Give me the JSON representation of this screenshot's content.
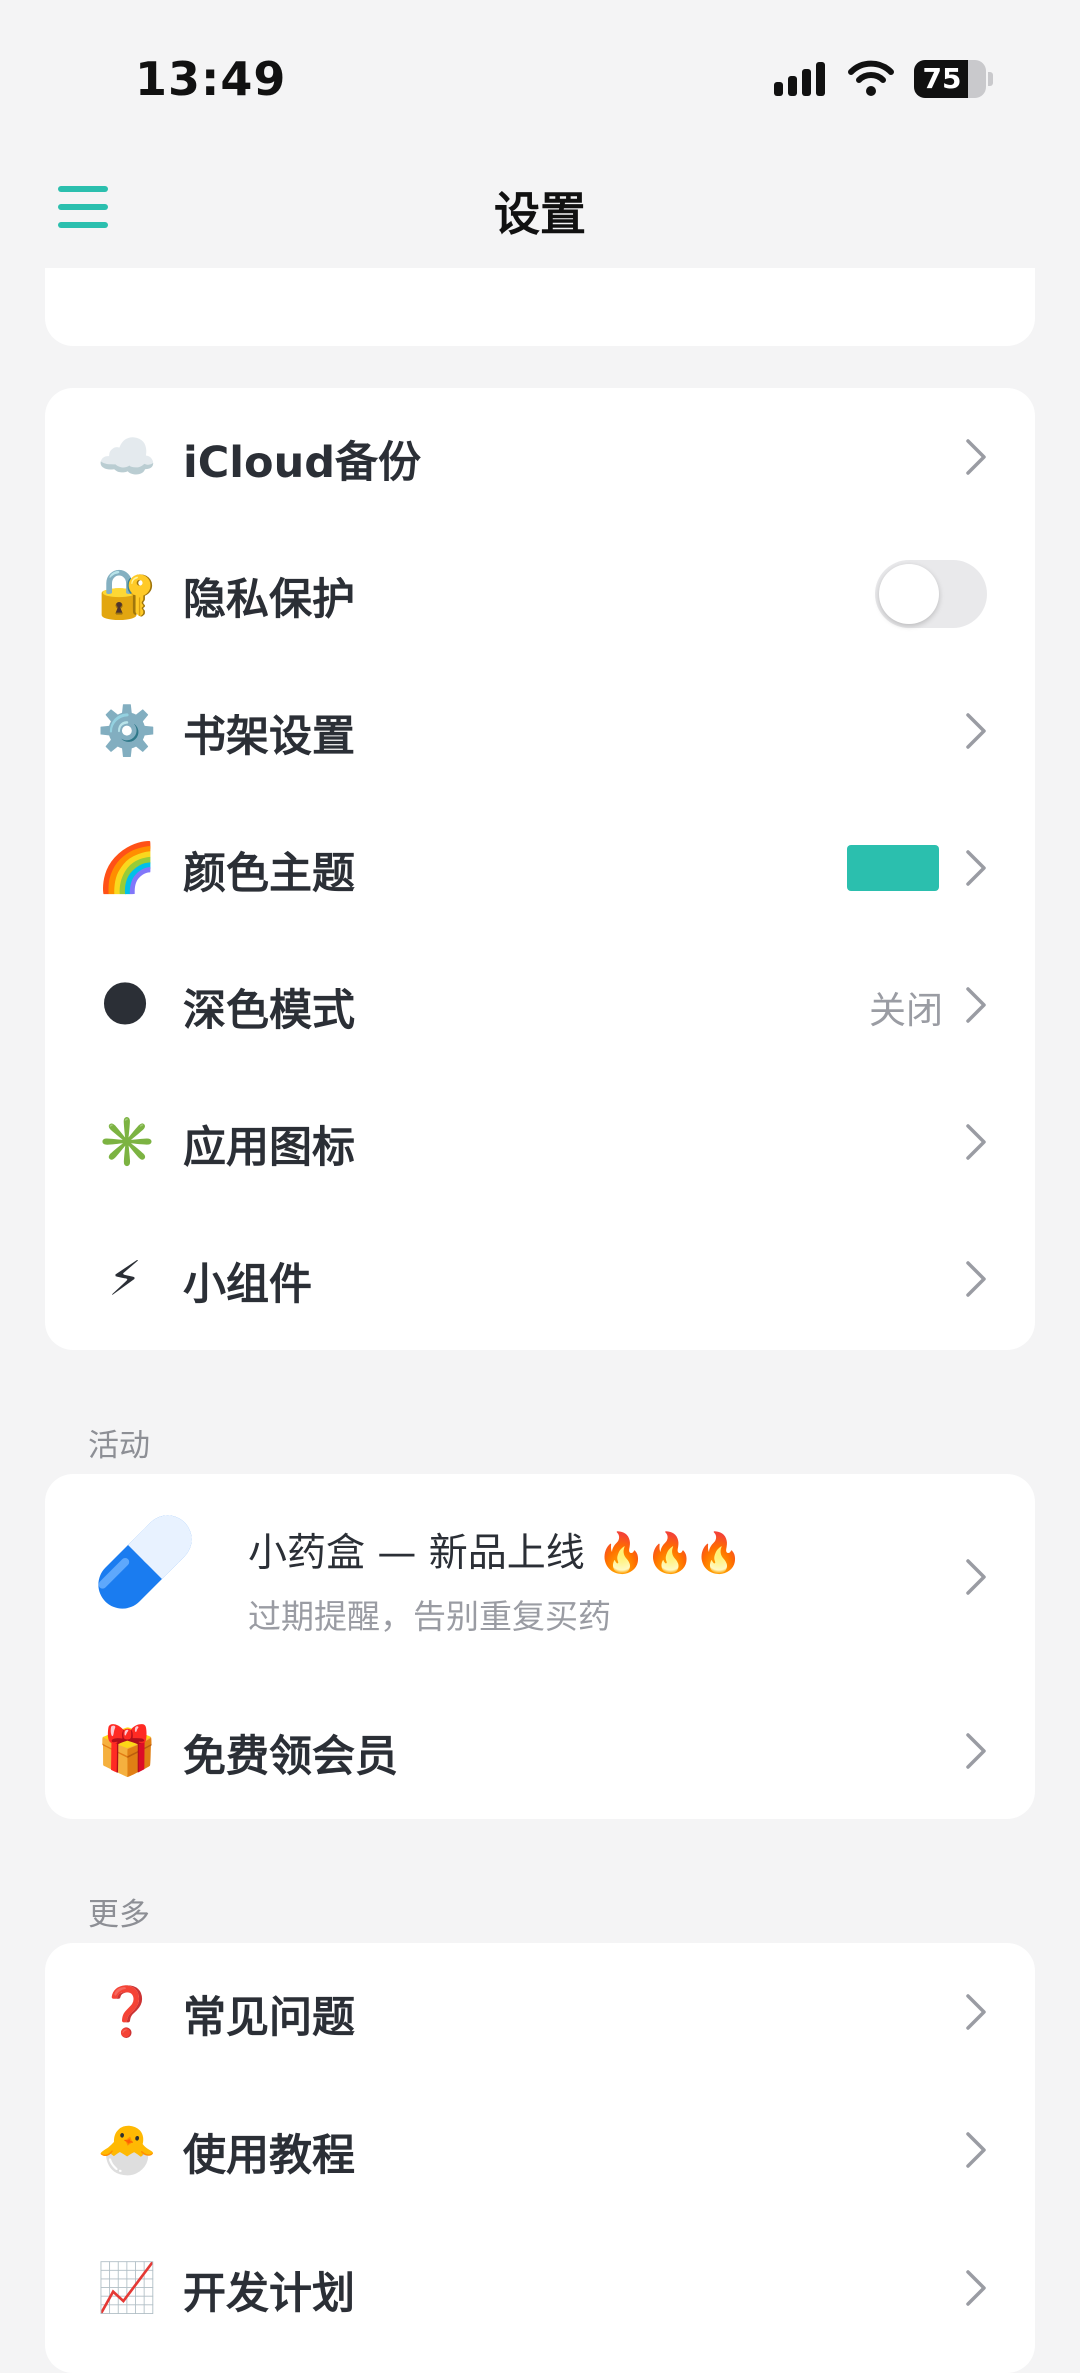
{
  "status_bar": {
    "time": "13:49",
    "battery_level": "75",
    "battery_fraction": 0.75
  },
  "nav": {
    "title": "设置",
    "menu_icon": "hamburger-menu-icon",
    "accent_color": "#2bbfae"
  },
  "settings": [
    {
      "icon": "☁️",
      "icon_name": "cloud-icon",
      "label": "iCloud备份"
    },
    {
      "icon": "🔐",
      "icon_name": "lock-key-icon",
      "label": "隐私保护",
      "toggle": false
    },
    {
      "icon": "⚙️",
      "icon_name": "gear-icon",
      "label": "书架设置"
    },
    {
      "icon": "🌈",
      "icon_name": "rainbow-icon",
      "label": "颜色主题",
      "swatch_color": "#2bbfae"
    },
    {
      "icon": "🌑",
      "icon_name": "new-moon-icon",
      "label": "深色模式",
      "value": "关闭"
    },
    {
      "icon": "✳️",
      "icon_name": "asterisk-icon",
      "label": "应用图标"
    },
    {
      "icon": "⚡",
      "icon_name": "lightning-icon",
      "label": "小组件"
    }
  ],
  "activity": {
    "header": "活动",
    "promo": {
      "title": "小药盒 — 新品上线 🔥🔥🔥",
      "subtitle": "过期提醒，告别重复买药",
      "image_name": "pill-capsule-icon"
    },
    "items": [
      {
        "icon": "🎁",
        "icon_name": "gift-icon",
        "label": "免费领会员"
      }
    ]
  },
  "more": {
    "header": "更多",
    "items": [
      {
        "icon": "❓",
        "icon_name": "question-mark-icon",
        "label": "常见问题"
      },
      {
        "icon": "🐣",
        "icon_name": "hatching-chick-icon",
        "label": "使用教程"
      },
      {
        "icon": "📈",
        "icon_name": "chart-increasing-icon",
        "label": "开发计划"
      }
    ]
  }
}
